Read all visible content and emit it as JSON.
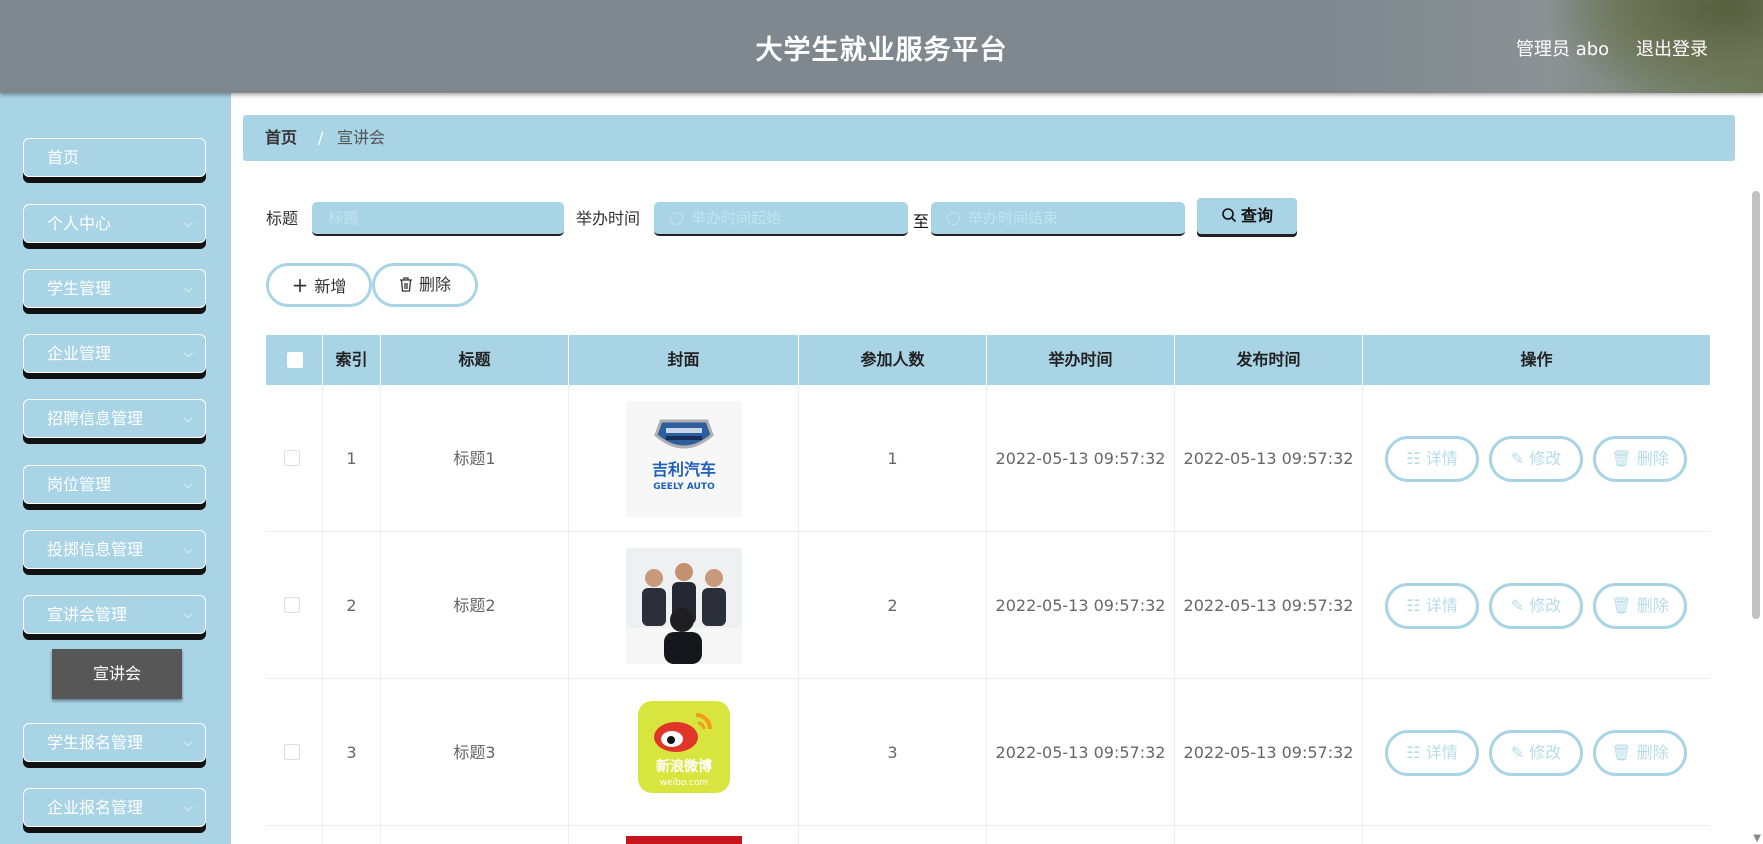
{
  "header": {
    "title": "大学生就业服务平台",
    "user": "管理员 abo",
    "logout": "退出登录"
  },
  "sidebar": {
    "items": [
      {
        "label": "首页"
      },
      {
        "label": "个人中心"
      },
      {
        "label": "学生管理"
      },
      {
        "label": "企业管理"
      },
      {
        "label": "招聘信息管理"
      },
      {
        "label": "岗位管理"
      },
      {
        "label": "投掷信息管理"
      },
      {
        "label": "宣讲会管理"
      },
      {
        "label": "学生报名管理"
      },
      {
        "label": "企业报名管理"
      }
    ],
    "submenu": {
      "label": "宣讲会"
    }
  },
  "breadcrumb": {
    "home": "首页",
    "sep": "/",
    "current": "宣讲会"
  },
  "search": {
    "title_label": "标题",
    "title_placeholder": "标题",
    "time_label": "举办时间",
    "start_placeholder": "举办时间起始",
    "to_label": "至",
    "end_placeholder": "举办时间结束",
    "query_label": "查询"
  },
  "actions": {
    "add_label": "新增",
    "delete_label": "删除"
  },
  "table": {
    "headers": [
      "索引",
      "标题",
      "封面",
      "参加人数",
      "举办时间",
      "发布时间",
      "操作"
    ],
    "row_actions": {
      "detail": "详情",
      "edit": "修改",
      "delete": "删除"
    },
    "rows": [
      {
        "index": "1",
        "title": "标题1",
        "cover": "吉利汽车 GEELY AUTO logo",
        "count": "1",
        "hold_time": "2022-05-13 09:57:32",
        "publish_time": "2022-05-13 09:57:32"
      },
      {
        "index": "2",
        "title": "标题2",
        "cover": "business meeting photo",
        "count": "2",
        "hold_time": "2022-05-13 09:57:32",
        "publish_time": "2022-05-13 09:57:32"
      },
      {
        "index": "3",
        "title": "标题3",
        "cover": "新浪微博 weibo.com logo",
        "count": "3",
        "hold_time": "2022-05-13 09:57:32",
        "publish_time": "2022-05-13 09:57:32"
      }
    ]
  },
  "logo_text": {
    "geely_cn": "吉利汽车",
    "geely_en": "GEELY AUTO",
    "weibo_cn": "新浪微博",
    "weibo_en": "weibo.com"
  },
  "colors": {
    "accent": "#a8d4e6",
    "header": "#7e888e",
    "submenu_active": "#575757"
  }
}
